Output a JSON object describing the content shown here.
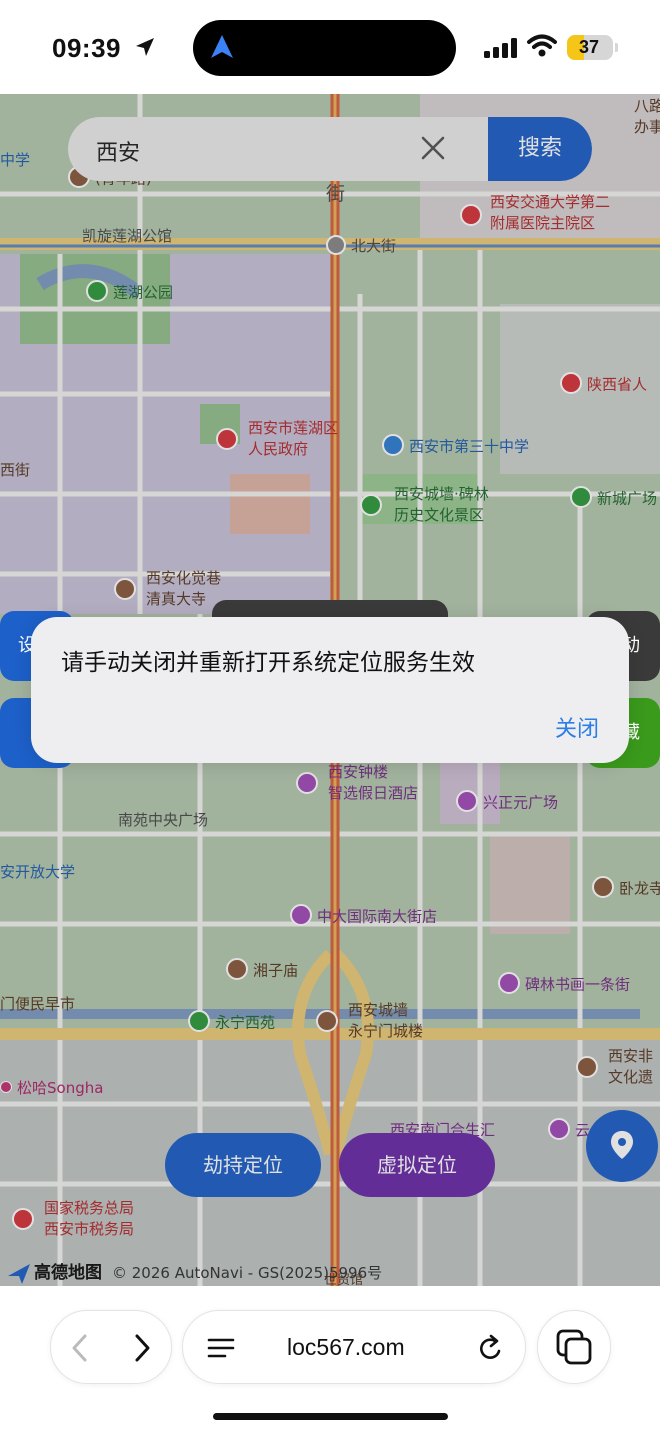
{
  "status_bar": {
    "time": "09:39",
    "battery_level": "37",
    "battery_fraction": 0.37,
    "icons": [
      "location-arrow-icon",
      "navigation-arrow-icon",
      "cellular-signal-icon",
      "wifi-icon",
      "battery-icon"
    ]
  },
  "search": {
    "value": "西安",
    "button_label": "搜索"
  },
  "map": {
    "labels": {
      "zhongxue": "中学",
      "qingnianlu": "(青年路)",
      "jie": "街",
      "kaixuan": "凯旋莲湖公馆",
      "xjtu_hospital_1": "西安交通大学第二",
      "xjtu_hospital_2": "附属医院主院区",
      "beidajie": "北大街",
      "badaban_1": "八路",
      "badaban_2": "办事",
      "lianhu_park": "莲湖公园",
      "shaanxi_prov": "陕西省人",
      "lianhu_gov_1": "西安市莲湖区",
      "lianhu_gov_2": "人民政府",
      "xi_jie": "西街",
      "school30": "西安市第三十中学",
      "beilin_1": "西安城墙·碑林",
      "beilin_2": "历史文化景区",
      "xincheng": "新城广场",
      "huajue_1": "西安化觉巷",
      "huajue_2": "清真大寺",
      "zhonglou_1": "西安钟楼",
      "zhonglou_2": "智选假日酒店",
      "xingzheng": "兴正元广场",
      "nanyuan": "南苑中央广场",
      "kaifang": "安开放大学",
      "wolong": "卧龙寺",
      "zhongda": "中大国际南大街店",
      "xiangzi": "湘子庙",
      "beilin_street": "碑林书画一条街",
      "bianmin": "门便民早市",
      "yongning_park": "永宁西苑",
      "yongning_gate_1": "西安城墙",
      "yongning_gate_2": "永宁门城楼",
      "feiyi_1": "西安非",
      "feiyi_2": "文化遗",
      "songha": "松哈Songha",
      "nanmen": "西安南门合生汇",
      "yun": "云",
      "tax_1": "国家税务总局",
      "tax_2": "西安市税务局",
      "shanxi_museum": "世贸馆"
    },
    "side_chip_left_1": "设",
    "side_chip_right_1": "动",
    "side_chip_right_2": "藏",
    "button_hijack": "劫持定位",
    "button_virtual": "虚拟定位",
    "attribution_logo": "高德地图",
    "attribution": "© 2026 AutoNavi - GS(2025)5996号",
    "colors": {
      "road_main": "#e9c46a",
      "road_arterial": "#d84b3f",
      "water": "#6f8fbf",
      "accent_blue": "#1d60c9",
      "accent_purple": "#6a2aa8",
      "accent_green": "#3a9a1c"
    }
  },
  "alert": {
    "message": "请手动关闭并重新打开系统定位服务生效",
    "close_label": "关闭"
  },
  "browser": {
    "url": "loc567.com"
  }
}
